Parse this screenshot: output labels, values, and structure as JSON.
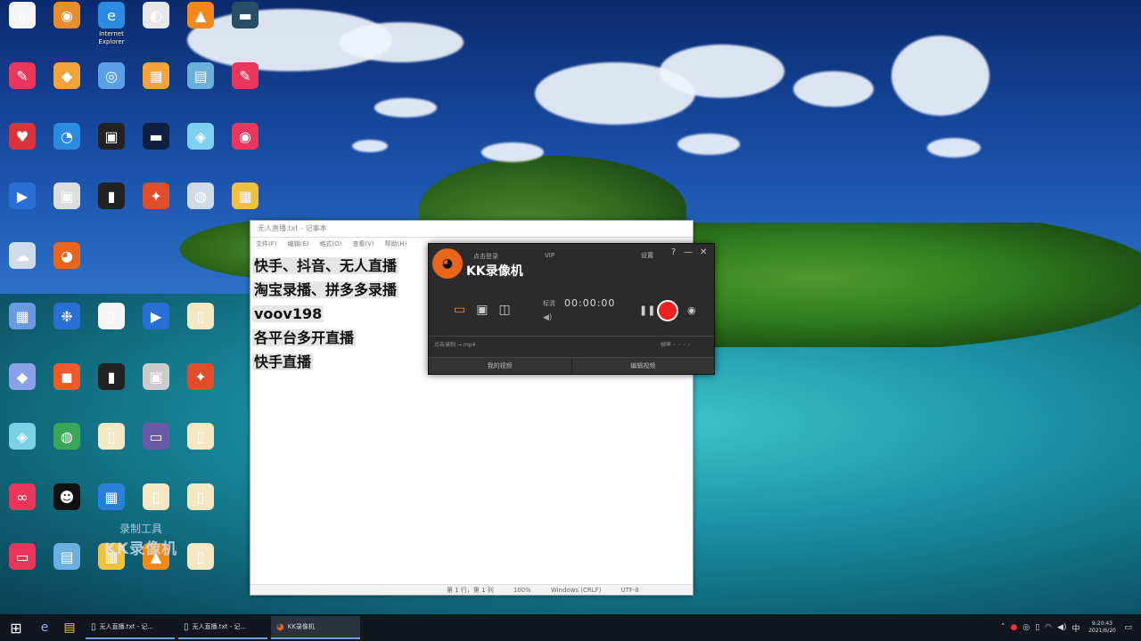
{
  "desktop": {
    "icons": [
      {
        "label": "",
        "icon": "file-icon",
        "color": "#f5f5f5",
        "glyph": "▯"
      },
      {
        "label": "",
        "icon": "app-icon",
        "color": "#e98c2a",
        "glyph": "◉"
      },
      {
        "label": "Internet Explorer",
        "icon": "ie-icon",
        "color": "#2a8be0",
        "glyph": "e"
      },
      {
        "label": "",
        "icon": "app-icon",
        "color": "#e7e7e7",
        "glyph": "◐"
      },
      {
        "label": "",
        "icon": "vlc-icon",
        "color": "#f08a1a",
        "glyph": "▲"
      },
      {
        "label": "",
        "icon": "app-icon",
        "color": "#2a4d66",
        "glyph": "▬"
      },
      {
        "label": "",
        "icon": "app-icon",
        "color": "#e8365c",
        "glyph": "✎"
      },
      {
        "label": "",
        "icon": "app-icon",
        "color": "#f2a33a",
        "glyph": "◆"
      },
      {
        "label": "",
        "icon": "app-icon",
        "color": "#5aa0e6",
        "glyph": "◎"
      },
      {
        "label": "",
        "icon": "folder-icon",
        "color": "#f2a33a",
        "glyph": "▦"
      },
      {
        "label": "",
        "icon": "app-icon",
        "color": "#6ab0d8",
        "glyph": "▤"
      },
      {
        "label": "",
        "icon": "app-icon",
        "color": "#e8365c",
        "glyph": "✎"
      },
      {
        "label": "",
        "icon": "heart-icon",
        "color": "#d8343a",
        "glyph": "♥"
      },
      {
        "label": "",
        "icon": "edge-icon",
        "color": "#2a8be0",
        "glyph": "◔"
      },
      {
        "label": "",
        "icon": "app-icon",
        "color": "#222",
        "glyph": "▣"
      },
      {
        "label": "",
        "icon": "app-icon",
        "color": "#102040",
        "glyph": "▬"
      },
      {
        "label": "",
        "icon": "app-icon",
        "color": "#7fd0f0",
        "glyph": "◈"
      },
      {
        "label": "",
        "icon": "app-icon",
        "color": "#e8365c",
        "glyph": "◉"
      },
      {
        "label": "",
        "icon": "app-icon",
        "color": "#2a6fd6",
        "glyph": "▶"
      },
      {
        "label": "",
        "icon": "app-icon",
        "color": "#ddd",
        "glyph": "▣"
      },
      {
        "label": "",
        "icon": "app-icon",
        "color": "#222",
        "glyph": "▮"
      },
      {
        "label": "",
        "icon": "app-icon",
        "color": "#e04d2a",
        "glyph": "✦"
      },
      {
        "label": "",
        "icon": "app-icon",
        "color": "#cfdbe8",
        "glyph": "◍"
      },
      {
        "label": "",
        "icon": "folder-icon",
        "color": "#f0c040",
        "glyph": "▦"
      },
      {
        "label": "",
        "icon": "app-icon",
        "color": "#cfdbe8",
        "glyph": "☁"
      },
      {
        "label": "",
        "icon": "kk-icon",
        "color": "#e9651b",
        "glyph": "◕"
      }
    ],
    "watermark_top": "录制工具",
    "watermark_bottom": "KK录像机"
  },
  "notepad": {
    "title": "无人直播.txt - 记事本",
    "menu": [
      "文件(F)",
      "编辑(E)",
      "格式(O)",
      "查看(V)",
      "帮助(H)"
    ],
    "lines": [
      "快手、抖音、无人直播",
      "淘宝录播、拼多多录播",
      "voov198",
      "各平台多开直播",
      "快手直播"
    ],
    "status_pos": "第 1 行，第 1 列",
    "status_zoom": "100%",
    "status_eol": "Windows (CRLF)",
    "status_enc": "UTF-8"
  },
  "recorder": {
    "small_title": "点击登录",
    "vip": "VIP",
    "brand": "KK录像机",
    "settings": "设置",
    "help": "?",
    "minimize": "—",
    "close": "✕",
    "quality": "标清",
    "timer": "00:00:00",
    "path_label": "点击录制 → mp4",
    "rate_label": "帧率 ◦ ◦ ◦ ◦",
    "tab_left": "我的视频",
    "tab_right": "编辑视频"
  },
  "taskbar": {
    "apps": [
      {
        "label": "无人直播.txt - 记...",
        "icon": "notepad-icon"
      },
      {
        "label": "无人直播.txt - 记...",
        "icon": "notepad-icon"
      },
      {
        "label": "KK录像机",
        "icon": "kk-icon"
      }
    ],
    "time": "9:20:43",
    "date": "2021/6/20"
  }
}
